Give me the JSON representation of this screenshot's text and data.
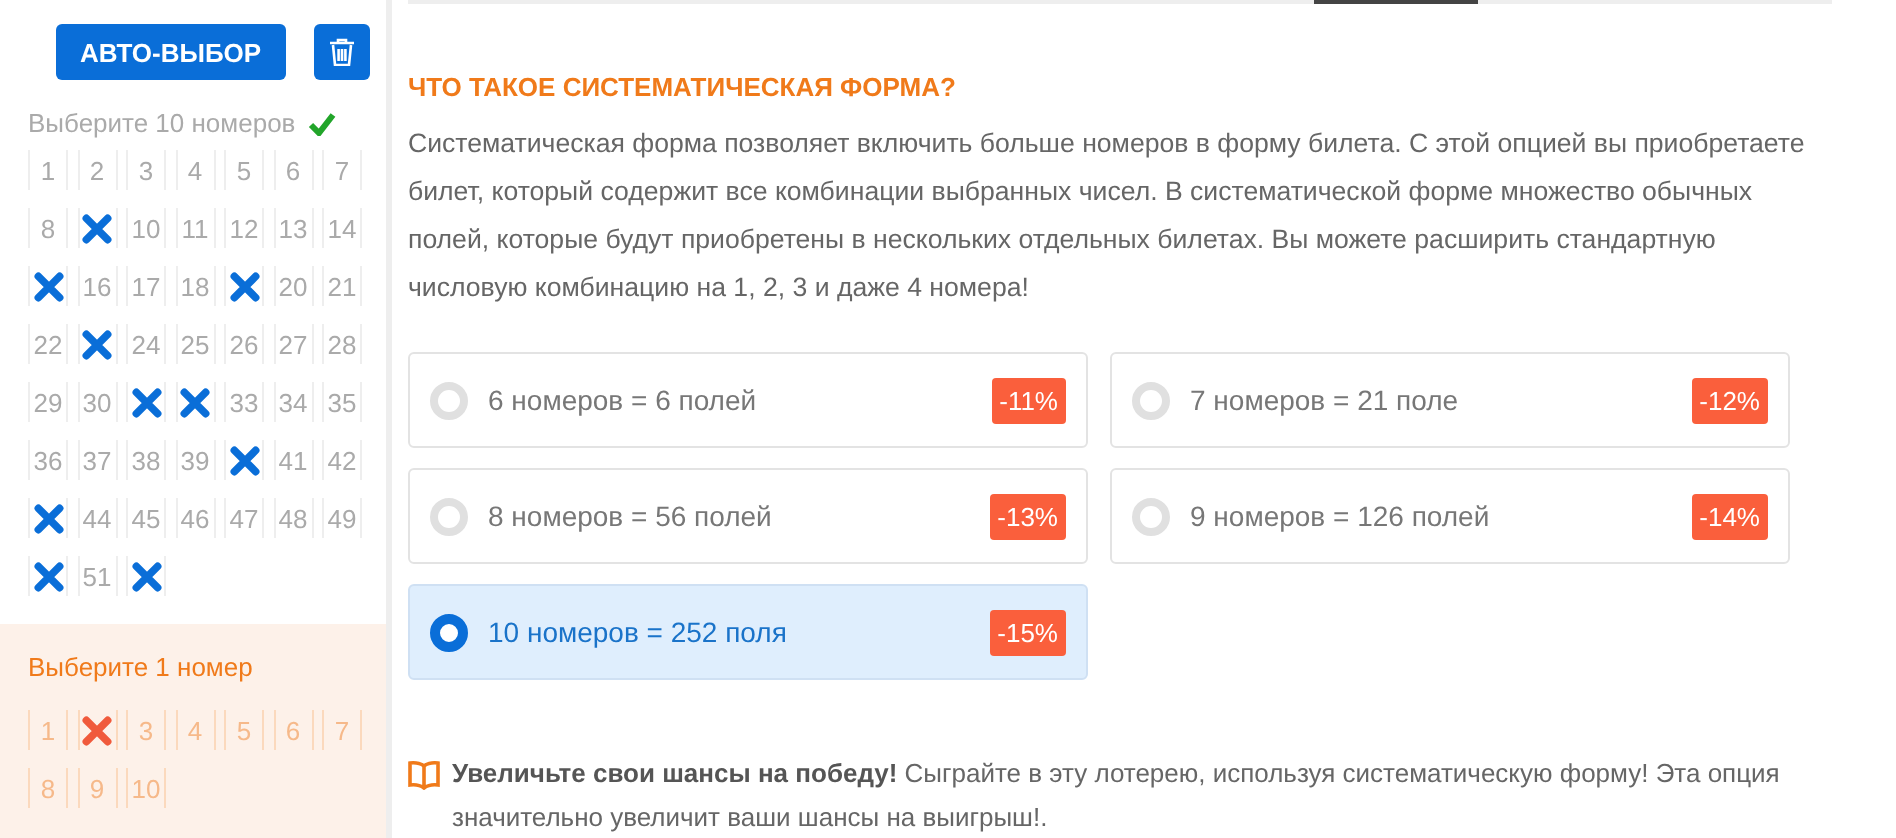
{
  "sidebar": {
    "auto_button": "АВТО-ВЫБОР",
    "main_pick": {
      "prompt": "Выберите 10 номеров",
      "complete": true,
      "numbers": [
        {
          "label": "1",
          "selected": false
        },
        {
          "label": "2",
          "selected": false
        },
        {
          "label": "3",
          "selected": false
        },
        {
          "label": "4",
          "selected": false
        },
        {
          "label": "5",
          "selected": false
        },
        {
          "label": "6",
          "selected": false
        },
        {
          "label": "7",
          "selected": false
        },
        {
          "label": "8",
          "selected": false
        },
        {
          "selected": true
        },
        {
          "label": "10",
          "selected": false
        },
        {
          "label": "11",
          "selected": false
        },
        {
          "label": "12",
          "selected": false
        },
        {
          "label": "13",
          "selected": false
        },
        {
          "label": "14",
          "selected": false
        },
        {
          "selected": true
        },
        {
          "label": "16",
          "selected": false
        },
        {
          "label": "17",
          "selected": false
        },
        {
          "label": "18",
          "selected": false
        },
        {
          "selected": true
        },
        {
          "label": "20",
          "selected": false
        },
        {
          "label": "21",
          "selected": false
        },
        {
          "label": "22",
          "selected": false
        },
        {
          "selected": true
        },
        {
          "label": "24",
          "selected": false
        },
        {
          "label": "25",
          "selected": false
        },
        {
          "label": "26",
          "selected": false
        },
        {
          "label": "27",
          "selected": false
        },
        {
          "label": "28",
          "selected": false
        },
        {
          "label": "29",
          "selected": false
        },
        {
          "label": "30",
          "selected": false
        },
        {
          "selected": true
        },
        {
          "selected": true
        },
        {
          "label": "33",
          "selected": false
        },
        {
          "label": "34",
          "selected": false
        },
        {
          "label": "35",
          "selected": false
        },
        {
          "label": "36",
          "selected": false
        },
        {
          "label": "37",
          "selected": false
        },
        {
          "label": "38",
          "selected": false
        },
        {
          "label": "39",
          "selected": false
        },
        {
          "selected": true
        },
        {
          "label": "41",
          "selected": false
        },
        {
          "label": "42",
          "selected": false
        },
        {
          "selected": true
        },
        {
          "label": "44",
          "selected": false
        },
        {
          "label": "45",
          "selected": false
        },
        {
          "label": "46",
          "selected": false
        },
        {
          "label": "47",
          "selected": false
        },
        {
          "label": "48",
          "selected": false
        },
        {
          "label": "49",
          "selected": false
        },
        {
          "selected": true
        },
        {
          "label": "51",
          "selected": false
        },
        {
          "selected": true
        }
      ]
    },
    "bonus_pick": {
      "prompt": "Выберите 1 номер",
      "numbers": [
        {
          "label": "1",
          "selected": false
        },
        {
          "selected": true
        },
        {
          "label": "3",
          "selected": false
        },
        {
          "label": "4",
          "selected": false
        },
        {
          "label": "5",
          "selected": false
        },
        {
          "label": "6",
          "selected": false
        },
        {
          "label": "7",
          "selected": false
        },
        {
          "label": "8",
          "selected": false
        },
        {
          "label": "9",
          "selected": false
        },
        {
          "label": "10",
          "selected": false
        }
      ]
    }
  },
  "info": {
    "heading": "ЧТО ТАКОЕ СИСТЕМАТИЧЕСКАЯ ФОРМА?",
    "text": "Систематическая форма позволяет включить больше номеров в форму билета. С этой опцией вы приобретаете билет, который содержит все комбинации выбранных чисел. В систематической форме множество обычных полей, которые будут приобретены в нескольких отдельных билетах. Вы можете расширить стандартную числовую комбинацию на 1, 2, 3 и даже 4 номера!"
  },
  "options": [
    {
      "label": "6 номеров = 6 полей",
      "discount": "-11%",
      "selected": false
    },
    {
      "label": "7 номеров = 21 поле",
      "discount": "-12%",
      "selected": false
    },
    {
      "label": "8 номеров = 56 полей",
      "discount": "-13%",
      "selected": false
    },
    {
      "label": "9 номеров = 126 полей",
      "discount": "-14%",
      "selected": false
    },
    {
      "label": "10 номеров = 252 поля",
      "discount": "-15%",
      "selected": true
    }
  ],
  "tip": "**Увеличьте свои шансы на победу!** Сыграйте в эту лотерею, используя систематическую форму! Эта опция значительно увеличит ваши шансы на выигрыш!."
}
